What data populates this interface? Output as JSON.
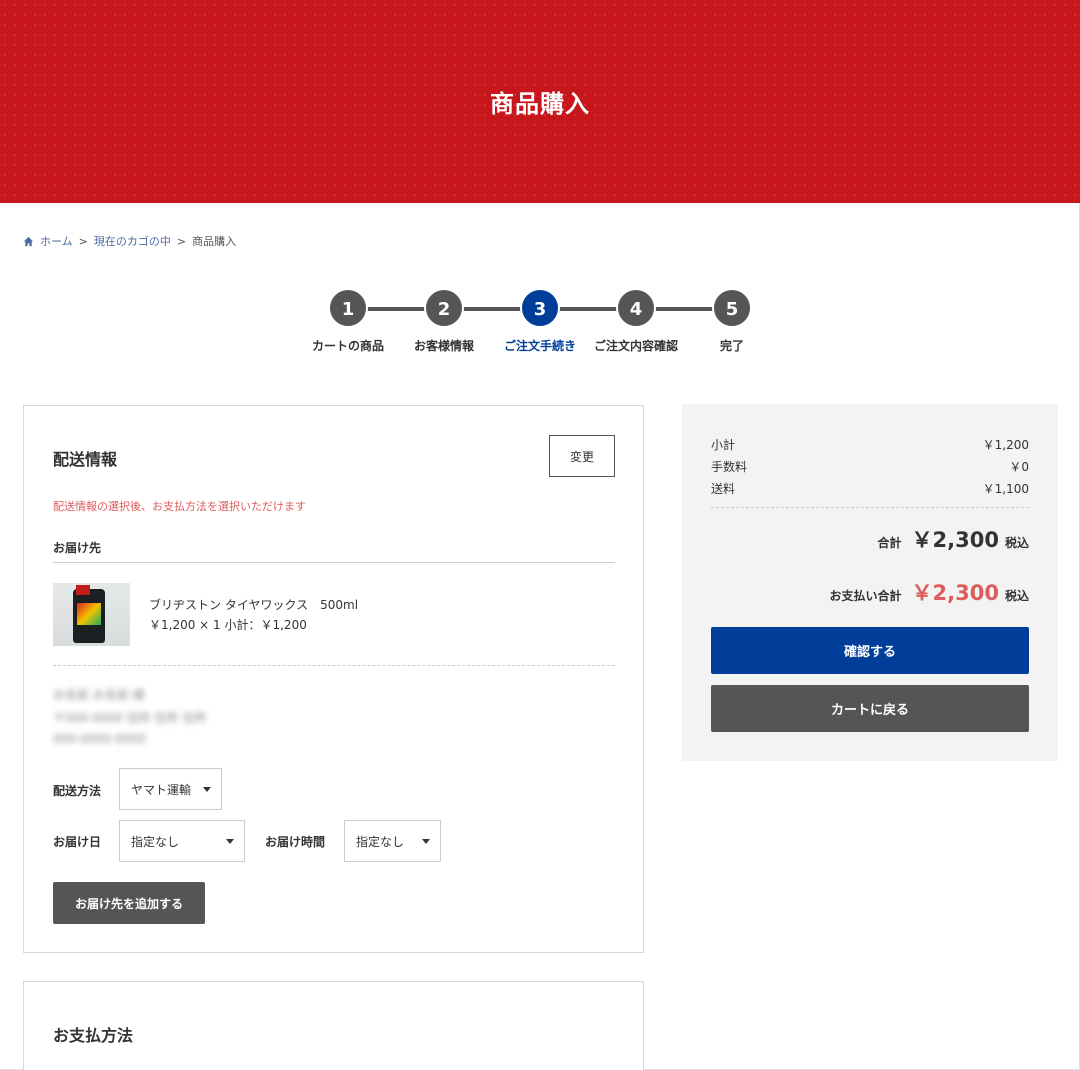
{
  "header": {
    "title": "商品購入"
  },
  "breadcrumb": {
    "home": "ホーム",
    "sep": ">",
    "cart": "現在のカゴの中",
    "current": "商品購入"
  },
  "steps": [
    {
      "number": "1",
      "label": "カートの商品"
    },
    {
      "number": "2",
      "label": "お客様情報"
    },
    {
      "number": "3",
      "label": "ご注文手続き",
      "active": true
    },
    {
      "number": "4",
      "label": "ご注文内容確認"
    },
    {
      "number": "5",
      "label": "完了"
    }
  ],
  "delivery": {
    "title": "配送情報",
    "change_button": "変更",
    "notice": "配送情報の選択後、お支払方法を選択いただけます",
    "ship_to_label": "お届け先",
    "product": {
      "name": "ブリヂストン タイヤワックス　500ml",
      "price_line": "￥1,200 × 1 小計：￥1,200"
    },
    "address_blurred": [
      "お名前 お名前 様",
      "〒000-0000 住所 住所 住所",
      "000-0000-0000"
    ],
    "shipping_method_label": "配送方法",
    "shipping_method_value": "ヤマト運輸",
    "delivery_date_label": "お届け日",
    "delivery_date_value": "指定なし",
    "delivery_time_label": "お届け時間",
    "delivery_time_value": "指定なし",
    "add_destination_button": "お届け先を追加する"
  },
  "payment": {
    "title": "お支払方法"
  },
  "summary": {
    "subtotal_label": "小計",
    "subtotal_value": "￥1,200",
    "fee_label": "手数料",
    "fee_value": "￥0",
    "shipping_label": "送料",
    "shipping_value": "￥1,100",
    "total_label": "合計",
    "total_value": "￥2,300",
    "tax_label": "税込",
    "payment_total_label": "お支払い合計",
    "payment_total_value": "￥2,300",
    "confirm_button": "確認する",
    "back_button": "カートに戻る"
  },
  "colors": {
    "brand_red": "#c8161d",
    "accent_blue": "#003e9a",
    "step_gray": "#555555",
    "notice_red": "#de5b5b"
  }
}
